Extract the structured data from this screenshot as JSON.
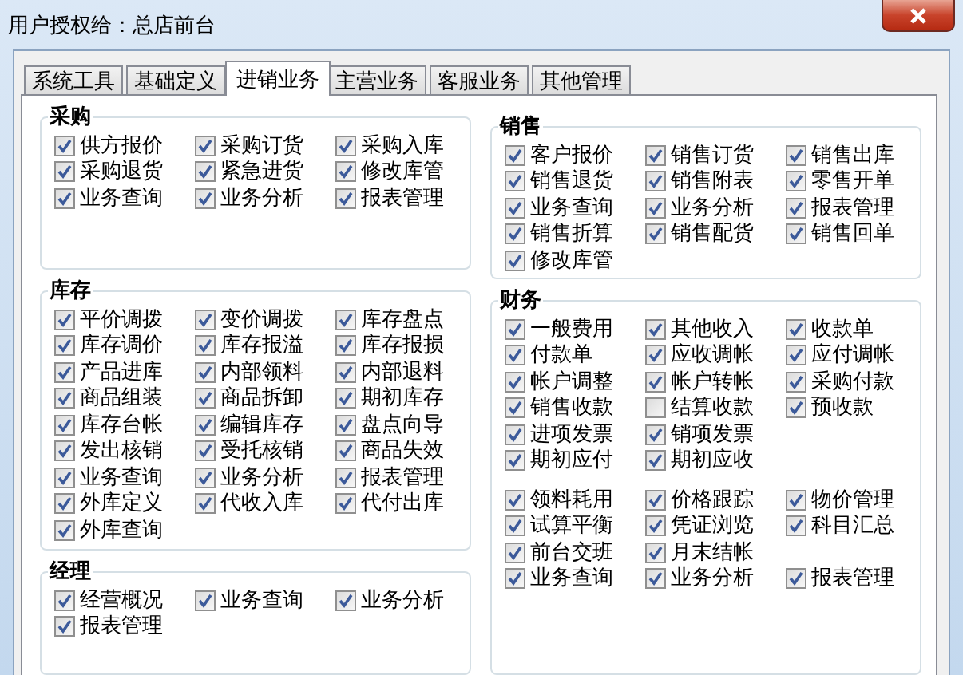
{
  "window": {
    "title": "用户授权给：总店前台"
  },
  "tabs": [
    {
      "label": "系统工具",
      "selected": false
    },
    {
      "label": "基础定义",
      "selected": false
    },
    {
      "label": "进销业务",
      "selected": true
    },
    {
      "label": "主营业务",
      "selected": false
    },
    {
      "label": "客服业务",
      "selected": false
    },
    {
      "label": "其他管理",
      "selected": false
    }
  ],
  "columns": [
    {
      "groups": [
        {
          "title": "采购",
          "sections": [
            {
              "rows": [
                [
                  {
                    "label": "供方报价",
                    "checked": true
                  },
                  {
                    "label": "采购订货",
                    "checked": true
                  },
                  {
                    "label": "采购入库",
                    "checked": true
                  }
                ],
                [
                  {
                    "label": "采购退货",
                    "checked": true
                  },
                  {
                    "label": "紧急进货",
                    "checked": true
                  },
                  {
                    "label": "修改库管",
                    "checked": true
                  }
                ],
                [
                  {
                    "label": "业务查询",
                    "checked": true
                  },
                  {
                    "label": "业务分析",
                    "checked": true
                  },
                  {
                    "label": "报表管理",
                    "checked": true
                  }
                ]
              ]
            }
          ]
        },
        {
          "title": "库存",
          "sections": [
            {
              "rows": [
                [
                  {
                    "label": "平价调拨",
                    "checked": true
                  },
                  {
                    "label": "变价调拨",
                    "checked": true
                  },
                  {
                    "label": "库存盘点",
                    "checked": true
                  }
                ],
                [
                  {
                    "label": "库存调价",
                    "checked": true
                  },
                  {
                    "label": "库存报溢",
                    "checked": true
                  },
                  {
                    "label": "库存报损",
                    "checked": true
                  }
                ],
                [
                  {
                    "label": "产品进库",
                    "checked": true
                  },
                  {
                    "label": "内部领料",
                    "checked": true
                  },
                  {
                    "label": "内部退料",
                    "checked": true
                  }
                ],
                [
                  {
                    "label": "商品组装",
                    "checked": true
                  },
                  {
                    "label": "商品拆卸",
                    "checked": true
                  },
                  {
                    "label": "期初库存",
                    "checked": true
                  }
                ],
                [
                  {
                    "label": "库存台帐",
                    "checked": true
                  },
                  {
                    "label": "编辑库存",
                    "checked": true
                  },
                  {
                    "label": "盘点向导",
                    "checked": true
                  }
                ],
                [
                  {
                    "label": "发出核销",
                    "checked": true
                  },
                  {
                    "label": "受托核销",
                    "checked": true
                  },
                  {
                    "label": "商品失效",
                    "checked": true
                  }
                ],
                [
                  {
                    "label": "业务查询",
                    "checked": true
                  },
                  {
                    "label": "业务分析",
                    "checked": true
                  },
                  {
                    "label": "报表管理",
                    "checked": true
                  }
                ],
                [
                  {
                    "label": "外库定义",
                    "checked": true
                  },
                  {
                    "label": "代收入库",
                    "checked": true
                  },
                  {
                    "label": "代付出库",
                    "checked": true
                  }
                ],
                [
                  {
                    "label": "外库查询",
                    "checked": true
                  }
                ]
              ]
            }
          ]
        },
        {
          "title": "经理",
          "sections": [
            {
              "rows": [
                [
                  {
                    "label": "经营概况",
                    "checked": true
                  },
                  {
                    "label": "业务查询",
                    "checked": true
                  },
                  {
                    "label": "业务分析",
                    "checked": true
                  }
                ],
                [
                  {
                    "label": "报表管理",
                    "checked": true
                  }
                ]
              ]
            }
          ]
        }
      ]
    },
    {
      "groups": [
        {
          "title": "销售",
          "sections": [
            {
              "rows": [
                [
                  {
                    "label": "客户报价",
                    "checked": true
                  },
                  {
                    "label": "销售订货",
                    "checked": true
                  },
                  {
                    "label": "销售出库",
                    "checked": true
                  }
                ],
                [
                  {
                    "label": "销售退货",
                    "checked": true
                  },
                  {
                    "label": "销售附表",
                    "checked": true
                  },
                  {
                    "label": "零售开单",
                    "checked": true
                  }
                ],
                [
                  {
                    "label": "业务查询",
                    "checked": true
                  },
                  {
                    "label": "业务分析",
                    "checked": true
                  },
                  {
                    "label": "报表管理",
                    "checked": true
                  }
                ],
                [
                  {
                    "label": "销售折算",
                    "checked": true
                  },
                  {
                    "label": "销售配货",
                    "checked": true
                  },
                  {
                    "label": "销售回单",
                    "checked": true
                  }
                ],
                [
                  {
                    "label": "修改库管",
                    "checked": true
                  }
                ]
              ]
            }
          ]
        },
        {
          "title": "财务",
          "sections": [
            {
              "rows": [
                [
                  {
                    "label": "一般费用",
                    "checked": true
                  },
                  {
                    "label": "其他收入",
                    "checked": true
                  },
                  {
                    "label": "收款单",
                    "checked": true
                  }
                ],
                [
                  {
                    "label": "付款单",
                    "checked": true
                  },
                  {
                    "label": "应收调帐",
                    "checked": true
                  },
                  {
                    "label": "应付调帐",
                    "checked": true
                  }
                ],
                [
                  {
                    "label": "帐户调整",
                    "checked": true
                  },
                  {
                    "label": "帐户转帐",
                    "checked": true
                  },
                  {
                    "label": "采购付款",
                    "checked": true
                  }
                ],
                [
                  {
                    "label": "销售收款",
                    "checked": true
                  },
                  {
                    "label": "结算收款",
                    "checked": false
                  },
                  {
                    "label": "预收款",
                    "checked": true
                  }
                ],
                [
                  {
                    "label": "进项发票",
                    "checked": true
                  },
                  {
                    "label": "销项发票",
                    "checked": true
                  }
                ],
                [
                  {
                    "label": "期初应付",
                    "checked": true
                  },
                  {
                    "label": "期初应收",
                    "checked": true
                  }
                ]
              ]
            },
            {
              "rows": [
                [
                  {
                    "label": "领料耗用",
                    "checked": true
                  },
                  {
                    "label": "价格跟踪",
                    "checked": true
                  },
                  {
                    "label": "物价管理",
                    "checked": true
                  }
                ],
                [
                  {
                    "label": "试算平衡",
                    "checked": true
                  },
                  {
                    "label": "凭证浏览",
                    "checked": true
                  },
                  {
                    "label": "科目汇总",
                    "checked": true
                  }
                ],
                [
                  {
                    "label": "前台交班",
                    "checked": true
                  },
                  {
                    "label": "月末结帐",
                    "checked": true
                  }
                ],
                [
                  {
                    "label": "业务查询",
                    "checked": true
                  },
                  {
                    "label": "业务分析",
                    "checked": true
                  },
                  {
                    "label": "报表管理",
                    "checked": true
                  }
                ]
              ]
            }
          ]
        }
      ]
    }
  ]
}
